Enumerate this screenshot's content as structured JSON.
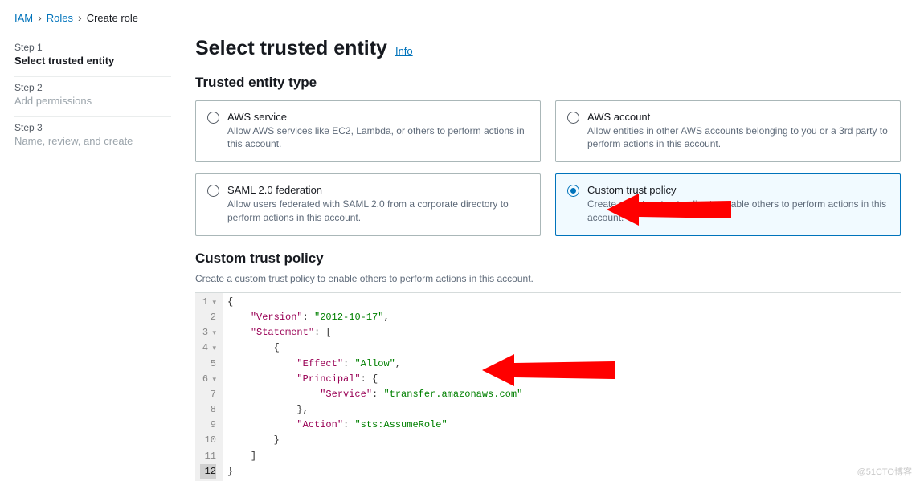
{
  "breadcrumb": {
    "iam": "IAM",
    "roles": "Roles",
    "current": "Create role"
  },
  "sidebar": {
    "steps": [
      {
        "num": "Step 1",
        "title": "Select trusted entity",
        "active": true
      },
      {
        "num": "Step 2",
        "title": "Add permissions",
        "active": false
      },
      {
        "num": "Step 3",
        "title": "Name, review, and create",
        "active": false
      }
    ]
  },
  "main": {
    "title": "Select trusted entity",
    "info": "Info",
    "section_entity_type": "Trusted entity type",
    "options": [
      {
        "id": "aws-service",
        "title": "AWS service",
        "desc": "Allow AWS services like EC2, Lambda, or others to perform actions in this account.",
        "selected": false
      },
      {
        "id": "aws-account",
        "title": "AWS account",
        "desc": "Allow entities in other AWS accounts belonging to you or a 3rd party to perform actions in this account.",
        "selected": false
      },
      {
        "id": "saml-federation",
        "title": "SAML 2.0 federation",
        "desc": "Allow users federated with SAML 2.0 from a corporate directory to perform actions in this account.",
        "selected": false
      },
      {
        "id": "custom-trust-policy",
        "title": "Custom trust policy",
        "desc": "Create a custom trust policy to enable others to perform actions in this account.",
        "selected": true
      }
    ],
    "custom_policy": {
      "heading": "Custom trust policy",
      "desc": "Create a custom trust policy to enable others to perform actions in this account."
    }
  },
  "editor": {
    "json": {
      "Version": "2012-10-17",
      "Statement": [
        {
          "Effect": "Allow",
          "Principal": {
            "Service": "transfer.amazonaws.com"
          },
          "Action": "sts:AssumeRole"
        }
      ]
    },
    "line_count": 12,
    "fold_lines": [
      1,
      3,
      4,
      6
    ],
    "current_line": 12
  },
  "watermark": "@51CTO博客"
}
